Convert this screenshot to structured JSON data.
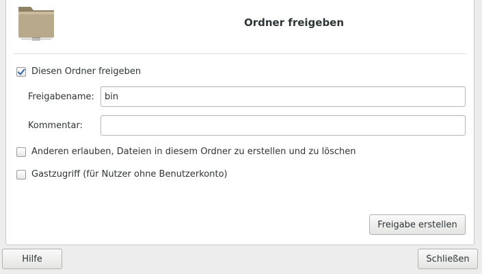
{
  "dialog": {
    "title": "Ordner freigeben",
    "icon": "folder-icon"
  },
  "share": {
    "checkbox_label": "Diesen Ordner freigeben",
    "checked": true
  },
  "fields": {
    "name_label": "Freigabename:",
    "name_value": "bin",
    "comment_label": "Kommentar:",
    "comment_value": ""
  },
  "options": {
    "allow_others_label": "Anderen erlauben, Dateien in diesem Ordner zu erstellen und zu löschen",
    "allow_others_checked": false,
    "guest_label": "Gastzugriff (für Nutzer ohne Benutzerkonto)",
    "guest_checked": false
  },
  "buttons": {
    "create_share": "Freigabe erstellen",
    "help": "Hilfe",
    "close": "Schließen"
  },
  "colors": {
    "checkmark": "#3d6ea8",
    "folder_body": "#b7a88a",
    "folder_tab": "#9a8b6e"
  }
}
